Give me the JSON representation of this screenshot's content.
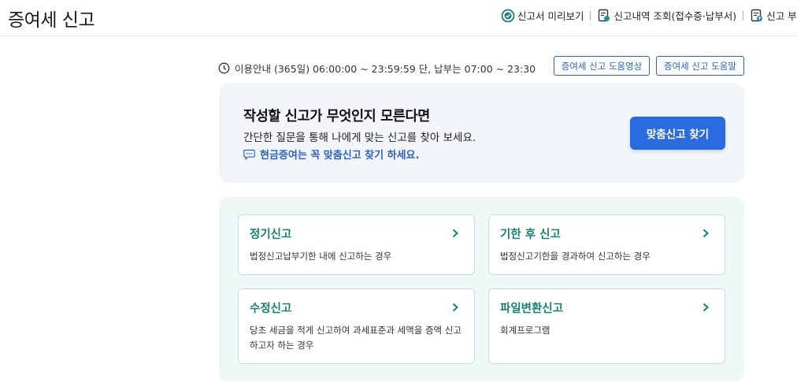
{
  "header": {
    "title": "증여세 신고",
    "links": [
      {
        "label": "신고서 미리보기",
        "icon": "check-badge-icon"
      },
      {
        "label": "신고내역 조회(접수증·납부서)",
        "icon": "document-search-icon"
      },
      {
        "label": "신고 부",
        "icon": "document-upload-icon"
      }
    ]
  },
  "notice": {
    "text": "이용안내 (365일) 06:00:00 ~ 23:59:59 단, 납부는 07:00 ~ 23:30",
    "icon": "clock-icon"
  },
  "help_buttons": {
    "video": "증여세 신고 도움영상",
    "help": "증여세 신고 도움말"
  },
  "finder": {
    "title": "작성할 신고가 무엇인지 모른다면",
    "subtitle": "간단한 질문을 통해 나에게 맞는 신고를 찾아 보세요.",
    "tip": "현금증여는 꼭 맞춤신고 찾기 하세요.",
    "button": "맞춤신고 찾기"
  },
  "cards": [
    {
      "title": "정기신고",
      "desc": "법정신고납부기한 내에 신고하는 경우"
    },
    {
      "title": "기한 후 신고",
      "desc": "법정신고기한을 경과하여 신고하는 경우"
    },
    {
      "title": "수정신고",
      "desc": "당초 세금을 적게 신고하여 과세표준과 세액을 증액 신고하고자 하는 경우"
    },
    {
      "title": "파일변환신고",
      "desc": "회계프로그램"
    }
  ],
  "colors": {
    "primary_blue": "#2a6be0",
    "teal_title": "#14807a",
    "finder_bg": "#f2f5fa",
    "cards_bg": "#eef8f6"
  }
}
